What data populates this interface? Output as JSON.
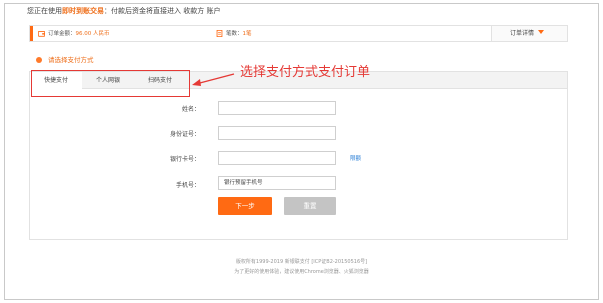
{
  "notice": {
    "prefix": "您正在使用",
    "highlight": "即时到账交易",
    "suffix": "：付款后资金将直接进入 收款方 账户"
  },
  "summary": {
    "amount_label": "订单金额：",
    "amount_value": "96.00 人民币",
    "order_label": "笔数：",
    "order_value": "1笔",
    "detail_label": "订单详情",
    "icons": {
      "amount": "wallet-icon",
      "order": "document-icon",
      "detail": "caret-down-icon"
    }
  },
  "section": {
    "title": "请选择支付方式"
  },
  "tabs": [
    {
      "label": "快捷支付",
      "active": true
    },
    {
      "label": "个人网银",
      "active": false
    },
    {
      "label": "扫码支付",
      "active": false
    }
  ],
  "annotation": {
    "text": "选择支付方式支付订单",
    "color": "#e53935"
  },
  "form": {
    "name_label": "姓名：",
    "name_value": "",
    "id_label": "身份证号：",
    "id_value": "",
    "card_label": "银行卡号：",
    "card_value": "",
    "limit_link": "限额",
    "phone_label": "手机号：",
    "phone_placeholder": "银行预留手机号"
  },
  "buttons": {
    "next": "下一步",
    "reset": "重置"
  },
  "footer": {
    "line1": "版权所有1999-2019 新银联支付 [ICP证B2-20150516号]",
    "line2": "为了更好的使用体验，建议使用Chrome浏览器、火狐浏览器"
  },
  "colors": {
    "accent": "#ff6a13",
    "link": "#2a7fd6",
    "annotation": "#e53935"
  }
}
